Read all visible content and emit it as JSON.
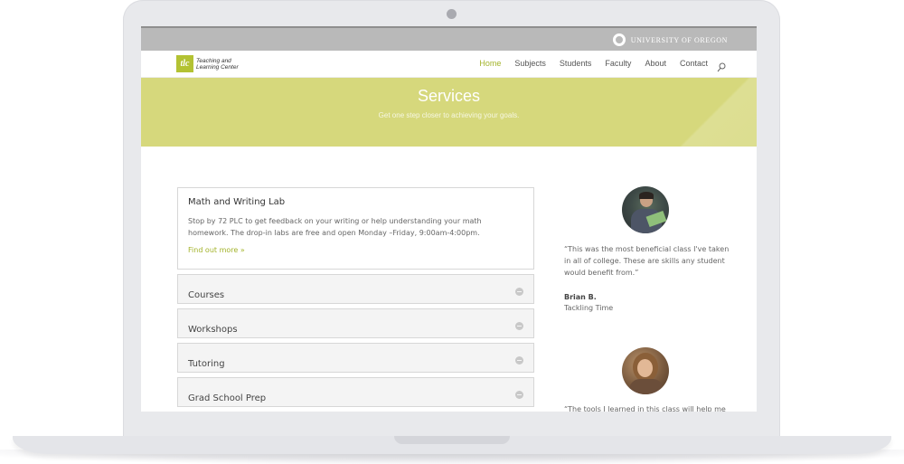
{
  "topbar": {
    "university": "UNIVERSITY OF OREGON"
  },
  "brand": {
    "mark": "tlc",
    "line1": "Teaching and",
    "line2": "Learning Center"
  },
  "nav": {
    "items": [
      {
        "label": "Home",
        "active": true
      },
      {
        "label": "Subjects",
        "active": false
      },
      {
        "label": "Students",
        "active": false
      },
      {
        "label": "Faculty",
        "active": false
      },
      {
        "label": "About",
        "active": false
      },
      {
        "label": "Contact",
        "active": false
      }
    ]
  },
  "hero": {
    "title": "Services",
    "subtitle": "Get one step closer to achieving your goals."
  },
  "accordion": {
    "open": {
      "title": "Math and Writing Lab",
      "body": "Stop by 72 PLC to get feedback on your writing or help understanding your math homework. The drop-in labs are free and open Monday –Friday, 9:00am-4:00pm.",
      "link": "Find out more »"
    },
    "items": [
      {
        "label": "Courses"
      },
      {
        "label": "Workshops"
      },
      {
        "label": "Tutoring"
      },
      {
        "label": "Grad School Prep"
      }
    ]
  },
  "testimonials": [
    {
      "quote": "“This was the most beneficial class I've taken in all of college. These are skills any student would benefit from.”",
      "author": "Brian B.",
      "role": "Tackling Time"
    },
    {
      "quote": "“The tools I learned in this class will help me"
    }
  ],
  "colors": {
    "accent": "#a3b32a",
    "hero": "#d6d87c",
    "topbar": "#b9b9b9"
  }
}
